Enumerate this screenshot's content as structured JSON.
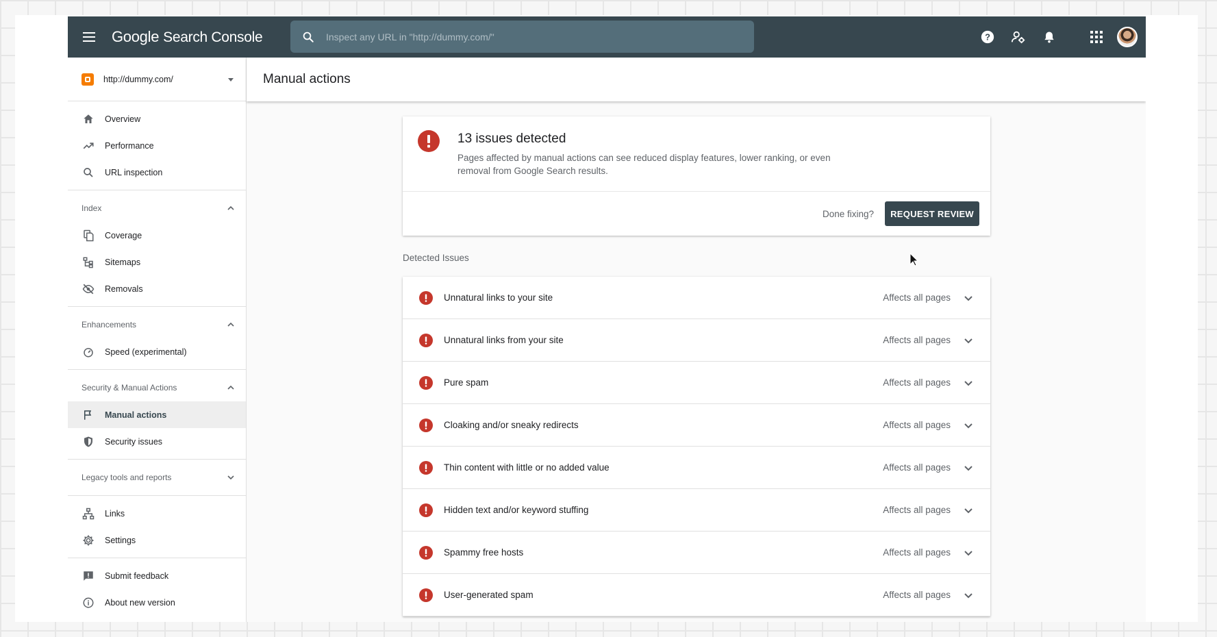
{
  "header": {
    "logo_google": "Google",
    "logo_product": "Search Console",
    "search_placeholder": "Inspect any URL in \"http://dummy.com/\""
  },
  "sidebar": {
    "property": "http://dummy.com/",
    "items_top": [
      {
        "label": "Overview",
        "icon": "home-icon"
      },
      {
        "label": "Performance",
        "icon": "trending-up-icon"
      },
      {
        "label": "URL inspection",
        "icon": "search-icon"
      }
    ],
    "index": {
      "title": "Index",
      "items": [
        {
          "label": "Coverage",
          "icon": "file-copy-icon"
        },
        {
          "label": "Sitemaps",
          "icon": "sitemap-icon"
        },
        {
          "label": "Removals",
          "icon": "visibility-off-icon"
        }
      ]
    },
    "enhancements": {
      "title": "Enhancements",
      "items": [
        {
          "label": "Speed (experimental)",
          "icon": "speed-icon"
        }
      ]
    },
    "security": {
      "title": "Security & Manual Actions",
      "items": [
        {
          "label": "Manual actions",
          "icon": "flag-icon",
          "active": true
        },
        {
          "label": "Security issues",
          "icon": "shield-icon"
        }
      ]
    },
    "legacy": {
      "title": "Legacy tools and reports"
    },
    "items_bottom": [
      {
        "label": "Links",
        "icon": "links-icon"
      },
      {
        "label": "Settings",
        "icon": "gear-icon"
      }
    ],
    "items_footer": [
      {
        "label": "Submit feedback",
        "icon": "feedback-icon"
      },
      {
        "label": "About new version",
        "icon": "info-icon"
      }
    ]
  },
  "main": {
    "page_title": "Manual actions",
    "summary": {
      "title": "13 issues detected",
      "description": "Pages affected by manual actions can see reduced display features, lower ranking, or even removal from Google Search results.",
      "done_fixing": "Done fixing?",
      "request_review": "REQUEST REVIEW"
    },
    "detected_label": "Detected Issues",
    "issues": [
      {
        "title": "Unnatural links to your site",
        "affects": "Affects all pages"
      },
      {
        "title": "Unnatural links from your site",
        "affects": "Affects all pages"
      },
      {
        "title": "Pure spam",
        "affects": "Affects all pages"
      },
      {
        "title": "Cloaking and/or sneaky redirects",
        "affects": "Affects all pages"
      },
      {
        "title": "Thin content with little or no added value",
        "affects": "Affects all pages"
      },
      {
        "title": "Hidden text and/or keyword stuffing",
        "affects": "Affects all pages"
      },
      {
        "title": "Spammy free hosts",
        "affects": "Affects all pages"
      },
      {
        "title": "User-generated spam",
        "affects": "Affects all pages"
      }
    ]
  },
  "colors": {
    "header_bg": "#37474f",
    "error_red": "#c5372c",
    "button_bg": "#37474f"
  }
}
